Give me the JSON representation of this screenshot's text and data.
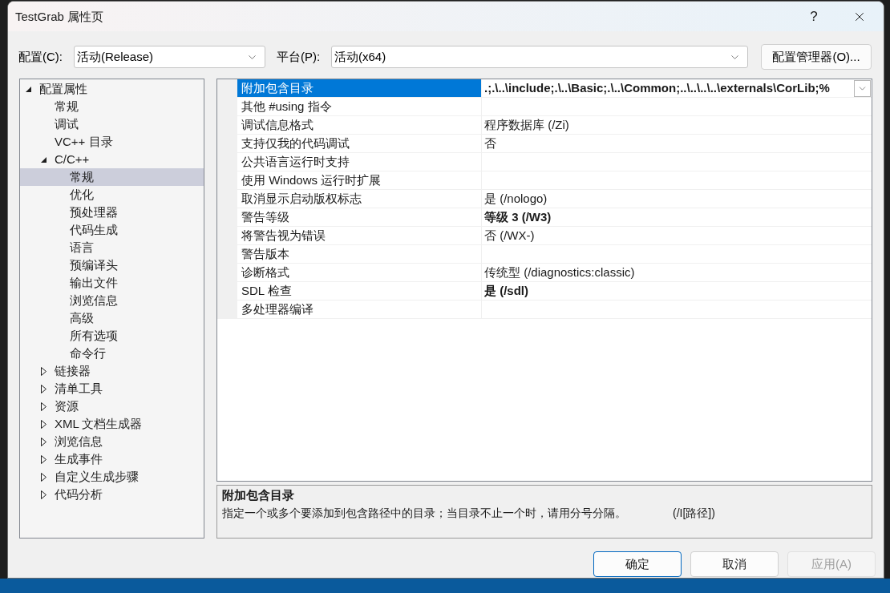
{
  "window": {
    "title": "TestGrab 属性页",
    "help_button": "?"
  },
  "toolbar": {
    "configuration": {
      "label": "配置(C):",
      "value": "活动(Release)"
    },
    "platform": {
      "label": "平台(P):",
      "value": "活动(x64)"
    },
    "manager_button": "配置管理器(O)..."
  },
  "tree": [
    {
      "label": "配置属性",
      "kind": "group",
      "expanded": true,
      "selected": false,
      "children": [
        {
          "label": "常规",
          "kind": "page",
          "selected": false
        },
        {
          "label": "调试",
          "kind": "page",
          "selected": false
        },
        {
          "label": "VC++ 目录",
          "kind": "page",
          "selected": false
        },
        {
          "label": "C/C++",
          "kind": "group",
          "expanded": true,
          "selected": false,
          "children": [
            {
              "label": "常规",
              "kind": "page",
              "selected": true
            },
            {
              "label": "优化",
              "kind": "page",
              "selected": false
            },
            {
              "label": "预处理器",
              "kind": "page",
              "selected": false
            },
            {
              "label": "代码生成",
              "kind": "page",
              "selected": false
            },
            {
              "label": "语言",
              "kind": "page",
              "selected": false
            },
            {
              "label": "预编译头",
              "kind": "page",
              "selected": false
            },
            {
              "label": "输出文件",
              "kind": "page",
              "selected": false
            },
            {
              "label": "浏览信息",
              "kind": "page",
              "selected": false
            },
            {
              "label": "高级",
              "kind": "page",
              "selected": false
            },
            {
              "label": "所有选项",
              "kind": "page",
              "selected": false
            },
            {
              "label": "命令行",
              "kind": "page",
              "selected": false
            }
          ]
        },
        {
          "label": "链接器",
          "kind": "group",
          "expanded": false,
          "selected": false
        },
        {
          "label": "清单工具",
          "kind": "group",
          "expanded": false,
          "selected": false
        },
        {
          "label": "资源",
          "kind": "group",
          "expanded": false,
          "selected": false
        },
        {
          "label": "XML 文档生成器",
          "kind": "group",
          "expanded": false,
          "selected": false
        },
        {
          "label": "浏览信息",
          "kind": "group",
          "expanded": false,
          "selected": false
        },
        {
          "label": "生成事件",
          "kind": "group",
          "expanded": false,
          "selected": false
        },
        {
          "label": "自定义生成步骤",
          "kind": "group",
          "expanded": false,
          "selected": false
        },
        {
          "label": "代码分析",
          "kind": "group",
          "expanded": false,
          "selected": false
        }
      ]
    }
  ],
  "properties": [
    {
      "name": "附加包含目录",
      "value": ".;.\\..\\include;.\\..\\Basic;.\\..\\Common;..\\..\\..\\..\\externals\\CorLib;%",
      "selected": true,
      "modified": true
    },
    {
      "name": "其他 #using 指令",
      "selected": false
    },
    {
      "name": "调试信息格式",
      "value": "程序数据库 (/Zi)",
      "selected": false,
      "modified": false
    },
    {
      "name": "支持仅我的代码调试",
      "value": "否",
      "selected": false,
      "modified": false
    },
    {
      "name": "公共语言运行时支持",
      "selected": false
    },
    {
      "name": "使用 Windows 运行时扩展",
      "selected": false
    },
    {
      "name": "取消显示启动版权标志",
      "value": "是 (/nologo)",
      "selected": false,
      "modified": false
    },
    {
      "name": "警告等级",
      "value": "等级 3 (/W3)",
      "selected": false,
      "modified": true
    },
    {
      "name": "将警告视为错误",
      "value": "否 (/WX-)",
      "selected": false,
      "modified": false
    },
    {
      "name": "警告版本",
      "selected": false
    },
    {
      "name": "诊断格式",
      "value": "传统型 (/diagnostics:classic)",
      "selected": false,
      "modified": false
    },
    {
      "name": "SDL 检查",
      "value": "是 (/sdl)",
      "selected": false,
      "modified": true
    },
    {
      "name": "多处理器编译",
      "selected": false
    }
  ],
  "description": {
    "title": "附加包含目录",
    "text": "指定一个或多个要添加到包含路径中的目录；当目录不止一个时，请用分号分隔。",
    "switch": "(/I[路径])"
  },
  "buttons": [
    {
      "label": "确定",
      "default": true,
      "disabled": false
    },
    {
      "label": "取消",
      "default": false,
      "disabled": false
    },
    {
      "label": "应用(A)",
      "default": false,
      "disabled": true
    }
  ]
}
